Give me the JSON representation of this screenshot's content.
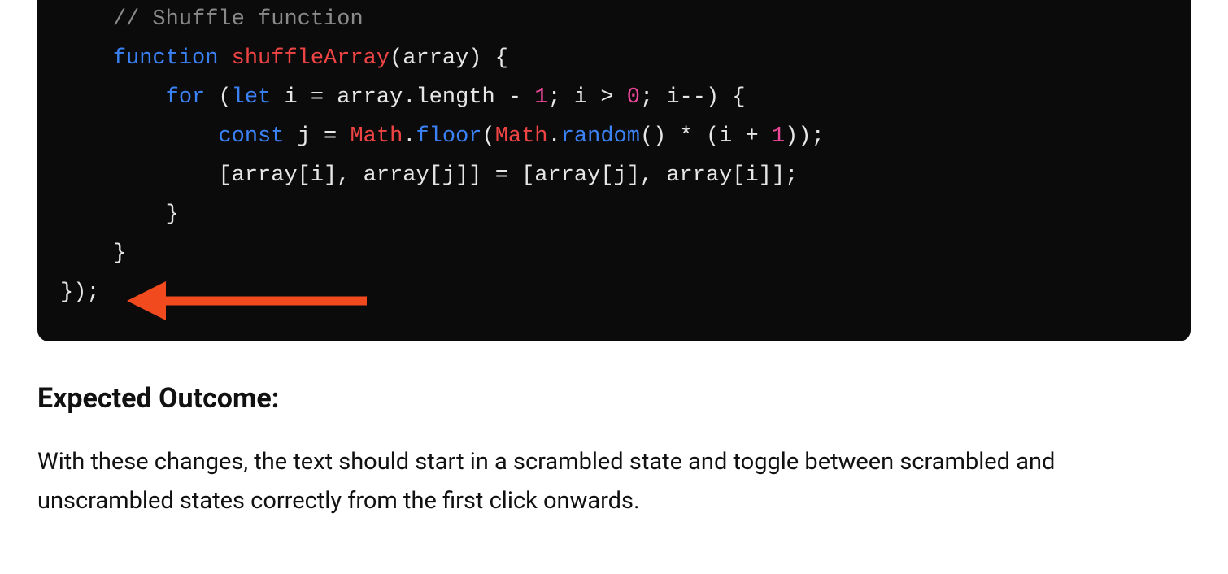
{
  "code": {
    "line1_comment": "// Shuffle function",
    "line2_kw_function": "function",
    "line2_name": "shuffleArray",
    "line2_rest": "(array) {",
    "line3_indent": "    ",
    "line3_for": "for",
    "line3_open": " (",
    "line3_let": "let",
    "line3_after_let": " i = array.length - ",
    "line3_num1": "1",
    "line3_mid": "; i > ",
    "line3_num0": "0",
    "line3_end": "; i--) {",
    "line4_indent": "        ",
    "line4_const": "const",
    "line4_after_const": " j = ",
    "line4_Math1": "Math",
    "line4_dot1": ".",
    "line4_floor": "floor",
    "line4_open2": "(",
    "line4_Math2": "Math",
    "line4_dot2": ".",
    "line4_random": "random",
    "line4_after_random": "() * (i + ",
    "line4_num1": "1",
    "line4_close": "));",
    "line5_indent": "        ",
    "line5_text": "[array[i], array[j]] = [array[j], array[i]];",
    "line6_indent": "    ",
    "line6_brace": "}",
    "line7_brace": "}",
    "line8_close": "});"
  },
  "headings": {
    "expected_outcome": "Expected Outcome:"
  },
  "paragraphs": {
    "outcome_body": "With these changes, the text should start in a scrambled state and toggle between scrambled and unscrambled states correctly from the first click onwards."
  },
  "annotation": {
    "arrow_color": "#f04a1e"
  }
}
